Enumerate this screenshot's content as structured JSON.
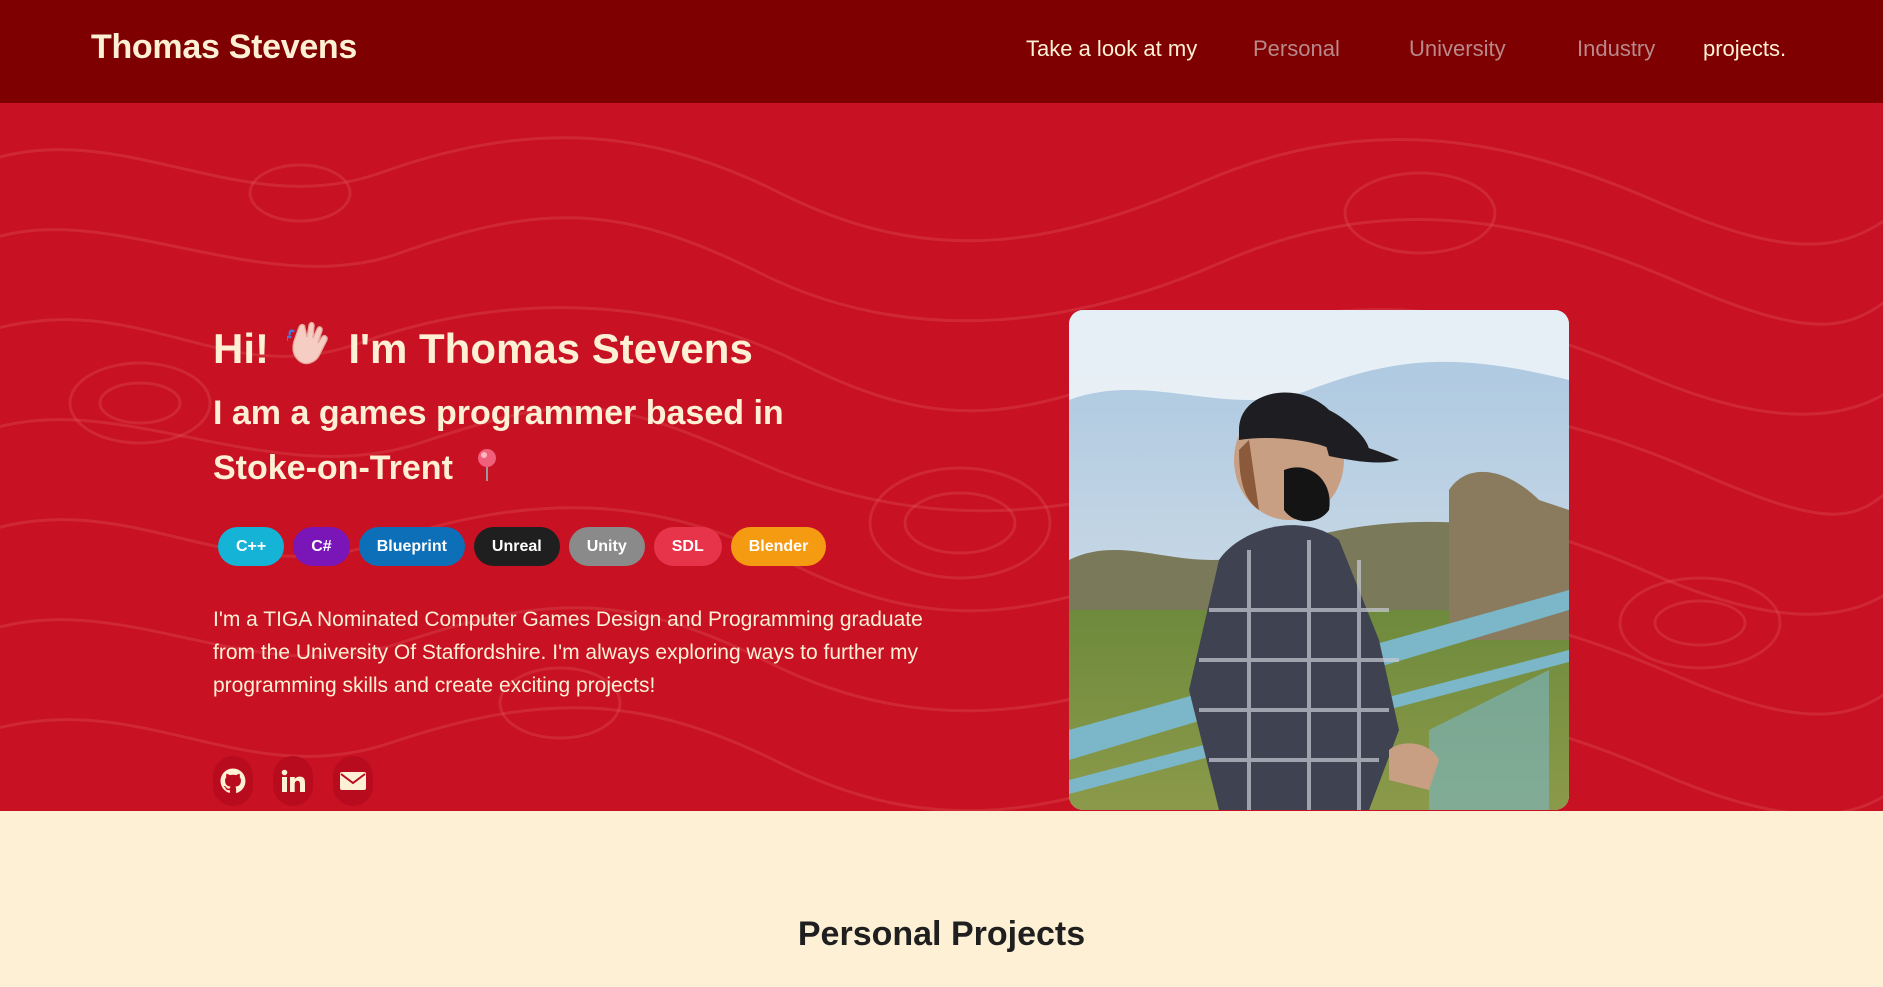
{
  "header": {
    "brand": "Thomas Stevens",
    "nav_lead": "Take a look at my",
    "nav_links": [
      "Personal",
      "University",
      "Industry"
    ],
    "nav_tail": "projects."
  },
  "hero": {
    "greeting": "Hi!",
    "greeting_name": "I'm Thomas Stevens",
    "subtitle": "I am a games programmer based in Stoke-on-Trent",
    "tags": [
      {
        "label": "C++",
        "color": "#15b3d6"
      },
      {
        "label": "C#",
        "color": "#7a16b8"
      },
      {
        "label": "Blueprint",
        "color": "#0d6fb8"
      },
      {
        "label": "Unreal",
        "color": "#1f1f1f"
      },
      {
        "label": "Unity",
        "color": "#8a8a8a"
      },
      {
        "label": "SDL",
        "color": "#e8344a"
      },
      {
        "label": "Blender",
        "color": "#f59b12"
      }
    ],
    "bio": "I'm a TIGA Nominated Computer Games Design and Programming graduate from the University Of Staffordshire. I'm always exploring ways to further my programming skills and create exciting projects!",
    "socials": [
      "github-icon",
      "linkedin-icon",
      "email-icon"
    ]
  },
  "section": {
    "title": "Personal Projects"
  },
  "colors": {
    "topbar": "#7f0000",
    "hero": "#c81122",
    "cream": "#fdf0d5"
  }
}
